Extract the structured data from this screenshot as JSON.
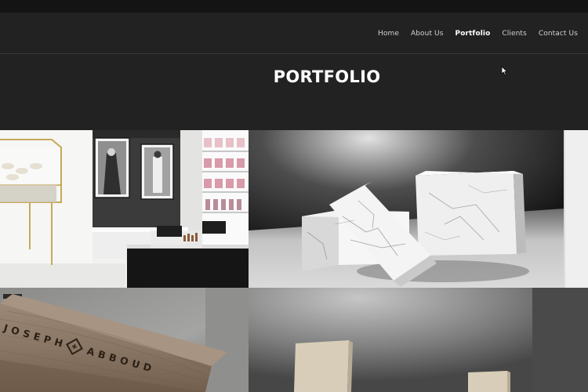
{
  "nav": {
    "items": [
      {
        "label": "Home",
        "active": false
      },
      {
        "label": "About Us",
        "active": false
      },
      {
        "label": "Portfolio",
        "active": true
      },
      {
        "label": "Clients",
        "active": false
      },
      {
        "label": "Contact Us",
        "active": false
      }
    ]
  },
  "hero": {
    "title": "PORTFOLIO"
  },
  "portfolio": {
    "tiles": [
      {
        "subject": "retail store interior with glass jewelry display case, framed black and white photos and cosmetics shelving"
      },
      {
        "subject": "white marble block display pedestals on dark gradient backdrop"
      },
      {
        "subject": "wooden display stand",
        "sign_text": "JOSEPH ABBOUD"
      },
      {
        "subject": "stone pedestals on grey gradient backdrop"
      }
    ]
  },
  "colors": {
    "background": "#222222",
    "top_strip": "#141414",
    "nav_text": "#d2d2d2",
    "nav_active": "#ffffff"
  }
}
